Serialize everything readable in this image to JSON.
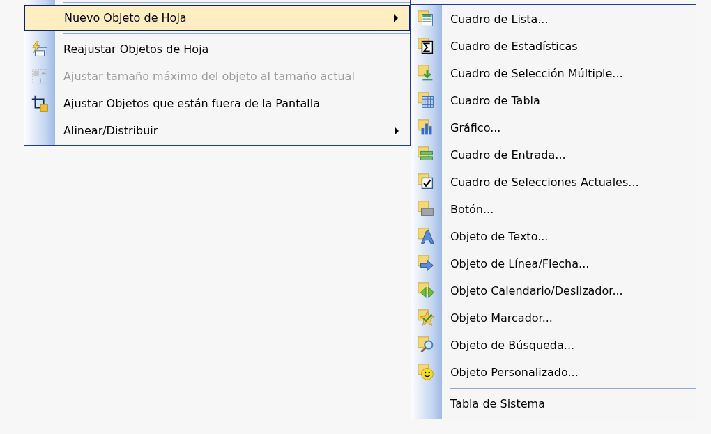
{
  "menu": {
    "items": [
      {
        "kind": "separator"
      },
      {
        "kind": "item",
        "label": "Nuevo Objeto de Hoja",
        "selected": true,
        "disabled": false,
        "submenu": true
      },
      {
        "kind": "separator"
      },
      {
        "kind": "item",
        "label": "Reajustar Objetos de Hoja",
        "selected": false,
        "disabled": false,
        "submenu": false
      },
      {
        "kind": "item",
        "label": "Ajustar tamaño máximo del objeto al tamaño actual",
        "selected": false,
        "disabled": true,
        "submenu": false
      },
      {
        "kind": "item",
        "label": "Ajustar Objetos que están fuera de la Pantalla",
        "selected": false,
        "disabled": false,
        "submenu": false
      },
      {
        "kind": "item",
        "label": "Alinear/Distribuir",
        "selected": false,
        "disabled": false,
        "submenu": true
      }
    ]
  },
  "submenu": {
    "items": [
      {
        "kind": "item",
        "label": "Cuadro de Lista..."
      },
      {
        "kind": "item",
        "label": "Cuadro de Estadísticas"
      },
      {
        "kind": "item",
        "label": "Cuadro de Selección Múltiple..."
      },
      {
        "kind": "item",
        "label": "Cuadro de Tabla"
      },
      {
        "kind": "item",
        "label": "Gráfico..."
      },
      {
        "kind": "item",
        "label": "Cuadro de Entrada..."
      },
      {
        "kind": "item",
        "label": "Cuadro de Selecciones Actuales..."
      },
      {
        "kind": "item",
        "label": "Botón..."
      },
      {
        "kind": "item",
        "label": "Objeto de Texto..."
      },
      {
        "kind": "item",
        "label": "Objeto de Línea/Flecha..."
      },
      {
        "kind": "item",
        "label": "Objeto Calendario/Deslizador..."
      },
      {
        "kind": "item",
        "label": "Objeto Marcador..."
      },
      {
        "kind": "item",
        "label": "Objeto de Búsqueda..."
      },
      {
        "kind": "item",
        "label": "Objeto Personalizado..."
      },
      {
        "kind": "separator"
      },
      {
        "kind": "item",
        "label": "Tabla de Sistema"
      }
    ]
  }
}
